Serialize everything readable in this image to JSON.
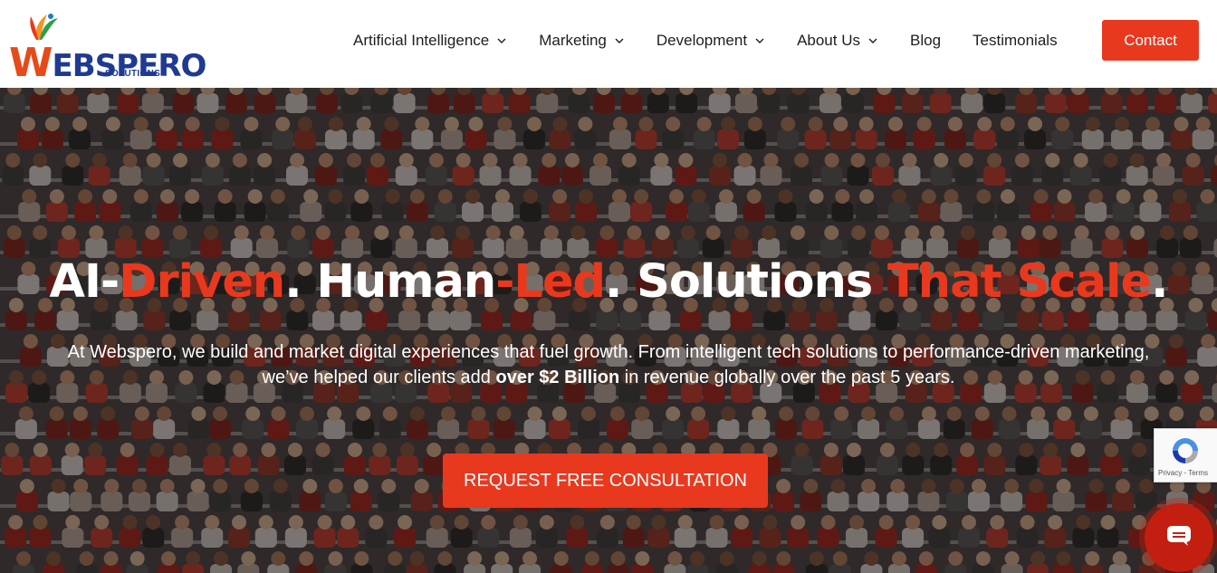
{
  "brand": {
    "logo_text": "WEBSPERO",
    "logo_sub": "SOLUTIONS"
  },
  "nav": {
    "items": [
      {
        "label": "Artificial Intelligence",
        "dropdown": true
      },
      {
        "label": "Marketing",
        "dropdown": true
      },
      {
        "label": "Development",
        "dropdown": true
      },
      {
        "label": "About Us",
        "dropdown": true
      },
      {
        "label": "Blog",
        "dropdown": false
      },
      {
        "label": "Testimonials",
        "dropdown": false
      }
    ],
    "contact_label": "Contact"
  },
  "hero": {
    "title_parts": [
      "AI-",
      "Driven",
      ". Human",
      "-Led",
      ". Solutions ",
      "That Scale",
      "."
    ],
    "desc_before": "At Webspero, we build and market digital experiences that fuel growth. From intelligent tech solutions to performance-driven marketing, we’ve helped our clients add ",
    "desc_bold": "over $2 Billion",
    "desc_after": " in revenue globally over the past 5 years.",
    "cta_label": "REQUEST FREE CONSULTATION"
  },
  "recaptcha": {
    "privacy": "Privacy",
    "separator": " - ",
    "terms": "Terms"
  },
  "colors": {
    "accent": "#e8391f",
    "brand_blue": "#1f3a93",
    "nav_text": "#1e1e1e"
  }
}
